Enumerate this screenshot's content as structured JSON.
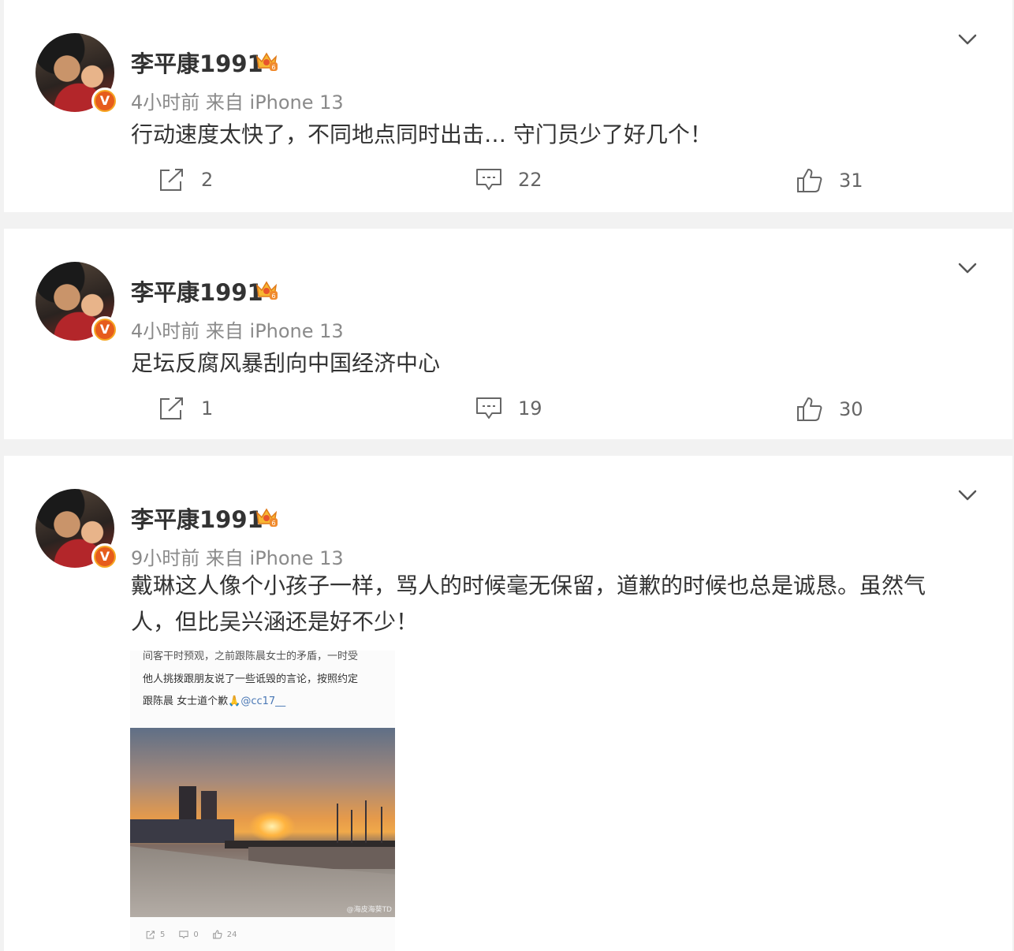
{
  "posts": [
    {
      "username": "李平康1991",
      "meta": "4小时前  来自 iPhone 13",
      "text": "行动速度太快了，不同地点同时出击… 守门员少了好几个！",
      "reposts": "2",
      "comments": "22",
      "likes": "31"
    },
    {
      "username": "李平康1991",
      "meta": "4小时前  来自 iPhone 13",
      "text": "足坛反腐风暴刮向中国经济中心",
      "reposts": "1",
      "comments": "19",
      "likes": "30"
    },
    {
      "username": "李平康1991",
      "meta": "9小时前  来自 iPhone 13",
      "text": "戴琳这人像个小孩子一样，骂人的时候毫无保留，道歉的时候也总是诚恳。虽然气人，但比吴兴涵还是好不少！",
      "embed": {
        "line0": "间客干时预观，之前跟陈晨女士的矛盾，一时受",
        "line1": "他人挑拨跟朋友说了一些诋毁的言论，按照约定",
        "line2": "跟陈晨 女士道个歉🙏",
        "mention": "@cc17__",
        "caption": "@海皮海葵TD",
        "reposts": "5",
        "comments": "0",
        "likes": "24"
      }
    }
  ],
  "badges": {
    "verified_letter": "V"
  },
  "icons": {
    "avatar": "avatar-photo",
    "crown": "crown-icon",
    "chevron": "chevron-down-icon",
    "share": "share-icon",
    "comment": "comment-icon",
    "like": "thumbs-up-icon"
  }
}
